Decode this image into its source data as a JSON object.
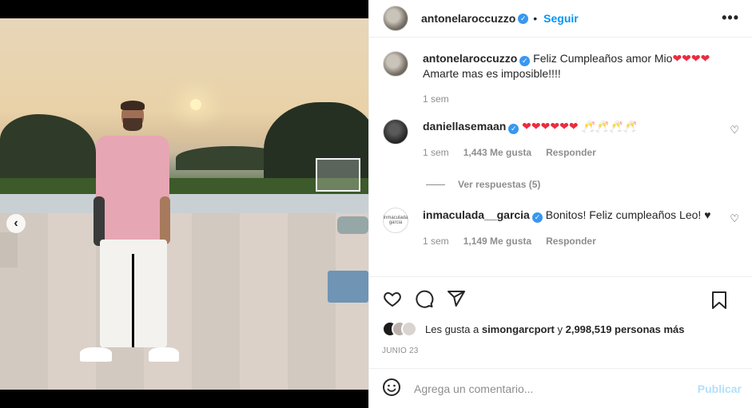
{
  "post": {
    "username": "antonelaroccuzzo",
    "follow_label": "Seguir",
    "separator": "•",
    "more_label": "•••",
    "carousel": {
      "dots": 3,
      "active_index": 2
    }
  },
  "caption": {
    "username": "antonelaroccuzzo",
    "text": "Feliz Cumpleaños amor Mio",
    "hearts": "❤❤❤❤",
    "line2": "Amarte mas es imposible!!!!",
    "time": "1 sem"
  },
  "comments": [
    {
      "username": "daniellasemaan",
      "text": "❤❤❤❤❤❤",
      "extra": "🥂🥂🥂🥂",
      "time": "1 sem",
      "likes": "1,443 Me gusta",
      "reply": "Responder",
      "view_replies": "Ver respuestas (5)"
    },
    {
      "username": "inmaculada__garcia",
      "avatar_text": "inmaculada garcia",
      "text": "Bonitos! Feliz cumpleaños Leo! ♥",
      "time": "1 sem",
      "likes": "1,149 Me gusta",
      "reply": "Responder"
    }
  ],
  "likes_summary": {
    "prefix": "Les gusta a",
    "user": "simongarcport",
    "connector": "y",
    "count": "2,998,519 personas más"
  },
  "date": "JUNIO 23",
  "composer": {
    "placeholder": "Agrega un comentario...",
    "post_label": "Publicar"
  },
  "icons": [
    "chevron-left-icon",
    "verified-icon",
    "more-icon",
    "heart-icon",
    "comment-icon",
    "share-icon",
    "bookmark-icon",
    "emoji-icon"
  ]
}
